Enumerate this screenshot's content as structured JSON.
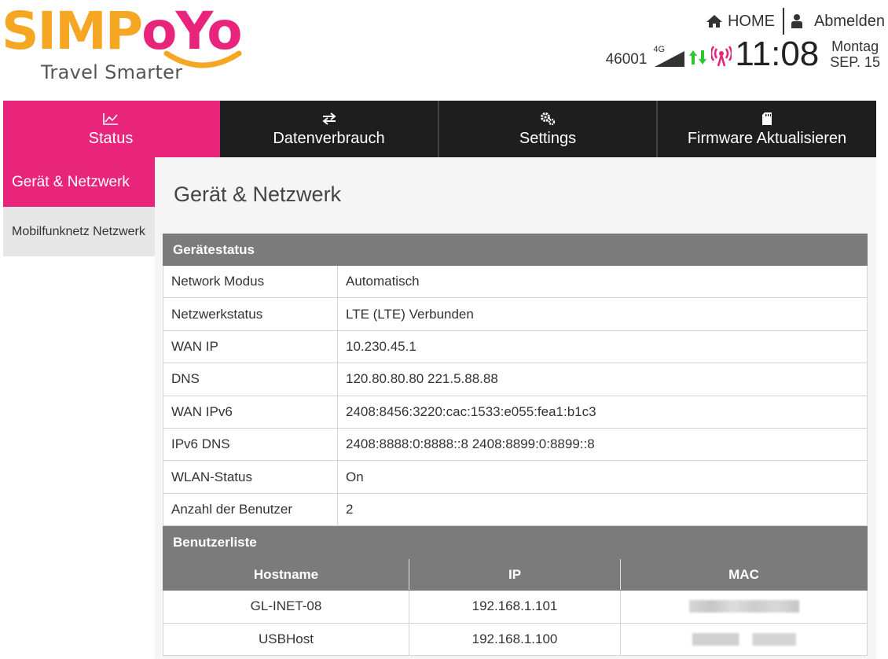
{
  "brand": {
    "logo_left": "SIMP",
    "logo_right": "oYo",
    "tagline": "Travel Smarter",
    "color_orange": "#f5a623",
    "color_pink": "#e8257a"
  },
  "toplinks": {
    "home_label": "HOME",
    "home_icon": "home-icon",
    "logout_label": "Abmelden",
    "logout_icon": "user-icon"
  },
  "statusbar": {
    "carrier": "46001",
    "network_type": "4G",
    "time": "11:08",
    "weekday": "Montag",
    "date": "SEP. 15",
    "icons": [
      "signal-icon",
      "traffic-arrows-icon",
      "wifi-broadcast-icon"
    ]
  },
  "nav": {
    "tabs": [
      {
        "label": "Status",
        "icon": "chart-icon",
        "active": true
      },
      {
        "label": "Datenverbrauch",
        "icon": "exchange-icon",
        "active": false
      },
      {
        "label": "Settings",
        "icon": "gears-icon",
        "active": false
      },
      {
        "label": "Firmware Aktualisieren",
        "icon": "sdcard-icon",
        "active": false
      }
    ]
  },
  "sidebar": {
    "items": [
      {
        "label": "Gerät & Netzwerk",
        "active": true
      },
      {
        "label": "Mobilfunknetz Netzwerk",
        "active": false
      }
    ]
  },
  "main": {
    "title": "Gerät & Netzwerk",
    "device_status": {
      "heading": "Gerätestatus",
      "rows": [
        {
          "key": "Network Modus",
          "value": "Automatisch"
        },
        {
          "key": "Netzwerkstatus",
          "value": "LTE (LTE) Verbunden"
        },
        {
          "key": "WAN IP",
          "value": "10.230.45.1"
        },
        {
          "key": "DNS",
          "value": "120.80.80.80 221.5.88.88"
        },
        {
          "key": "WAN IPv6",
          "value": "2408:8456:3220:cac:1533:e055:fea1:b1c3"
        },
        {
          "key": "IPv6 DNS",
          "value": "2408:8888:0:8888::8 2408:8899:0:8899::8"
        },
        {
          "key": "WLAN-Status",
          "value": "On"
        },
        {
          "key": "Anzahl der Benutzer",
          "value": "2"
        }
      ]
    },
    "user_list": {
      "heading": "Benutzerliste",
      "columns": [
        "Hostname",
        "IP",
        "MAC"
      ],
      "rows": [
        {
          "hostname": "GL-INET-08",
          "ip": "192.168.1.101"
        },
        {
          "hostname": "USBHost",
          "ip": "192.168.1.100"
        }
      ]
    }
  }
}
